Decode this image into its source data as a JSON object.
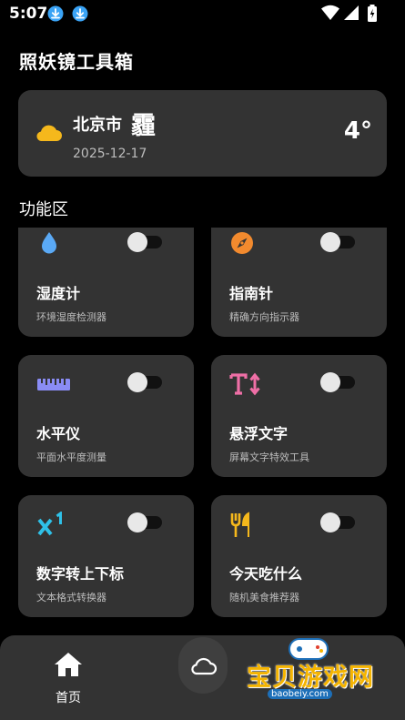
{
  "status_bar": {
    "time": "5:07",
    "icons": [
      "download-icon",
      "download-icon",
      "wifi-icon",
      "signal-icon",
      "battery-charging-icon"
    ]
  },
  "app": {
    "title": "照妖镜工具箱"
  },
  "weather": {
    "city": "北京市",
    "condition": "霾",
    "date": "2025-12-17",
    "temperature": "4°",
    "icon": "cloud-icon",
    "icon_color": "#f5b81c"
  },
  "section": {
    "title": "功能区"
  },
  "tools": [
    {
      "name": "湿度计",
      "desc": "环境湿度检测器",
      "icon": "water-drop-icon",
      "color": "#5aa9f5",
      "enabled": false
    },
    {
      "name": "指南针",
      "desc": "精确方向指示器",
      "icon": "compass-icon",
      "color": "#f28a2e",
      "enabled": false
    },
    {
      "name": "水平仪",
      "desc": "平面水平度测量",
      "icon": "ruler-icon",
      "color": "#8a8cf5",
      "enabled": false
    },
    {
      "name": "悬浮文字",
      "desc": "屏幕文字特效工具",
      "icon": "text-height-icon",
      "color": "#ef6fa6",
      "enabled": false
    },
    {
      "name": "数字转上下标",
      "desc": "文本格式转换器",
      "icon": "superscript-icon",
      "color": "#2fc1e8",
      "enabled": false
    },
    {
      "name": "今天吃什么",
      "desc": "随机美食推荐器",
      "icon": "fork-knife-icon",
      "color": "#f5b81c",
      "enabled": false
    }
  ],
  "bottom_nav": {
    "home_label": "首页",
    "home_icon": "home-icon",
    "weather_icon": "cloud-outline-icon"
  },
  "watermark": {
    "text": "宝贝游戏网",
    "url": "baobeiy.com"
  },
  "colors": {
    "background": "#000000",
    "card": "#333333",
    "accent_yellow": "#f5b81c"
  }
}
